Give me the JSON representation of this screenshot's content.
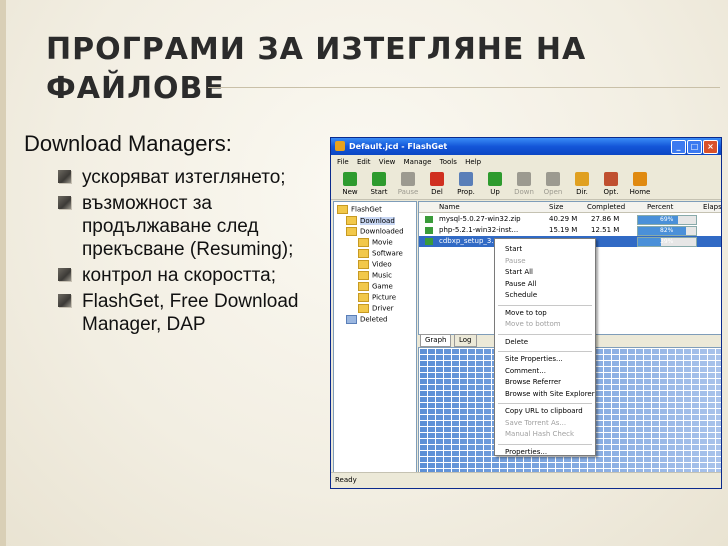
{
  "slide": {
    "title": "ПРОГРАМИ ЗА ИЗТЕГЛЯНЕ НА ФАЙЛОВЕ",
    "subtitle": "Download Managers:",
    "bullets": [
      "ускоряват изтеглянето;",
      "възможност за продължаване след прекъсване (Resuming);",
      "контрол на скоростта;",
      "FlashGet, Free Download Manager, DAP"
    ]
  },
  "window": {
    "title": "Default.jcd - FlashGet",
    "menu": [
      "File",
      "Edit",
      "View",
      "Manage",
      "Tools",
      "Help"
    ],
    "toolbar": [
      {
        "label": "New",
        "icon": "new-plus-icon",
        "color": "#2e9b2e",
        "enabled": true
      },
      {
        "label": "Start",
        "icon": "start-play-icon",
        "color": "#2e9b2e",
        "enabled": true
      },
      {
        "label": "Pause",
        "icon": "pause-icon",
        "color": "#9c9a90",
        "enabled": false
      },
      {
        "label": "Del",
        "icon": "delete-x-icon",
        "color": "#d03020",
        "enabled": true
      },
      {
        "label": "Prop.",
        "icon": "properties-icon",
        "color": "#5a7fb8",
        "enabled": true
      },
      {
        "label": "Up",
        "icon": "arrow-up-icon",
        "color": "#2e9b2e",
        "enabled": true
      },
      {
        "label": "Down",
        "icon": "arrow-down-icon",
        "color": "#9c9a90",
        "enabled": false
      },
      {
        "label": "Open",
        "icon": "open-arrow-icon",
        "color": "#9c9a90",
        "enabled": false
      },
      {
        "label": "Dir.",
        "icon": "directory-icon",
        "color": "#e0a020",
        "enabled": true
      },
      {
        "label": "Opt.",
        "icon": "options-icon",
        "color": "#c05030",
        "enabled": true
      },
      {
        "label": "Home",
        "icon": "home-icon",
        "color": "#e08a10",
        "enabled": true
      }
    ],
    "tree": {
      "root": "FlashGet",
      "download": "Download",
      "downloaded": "Downloaded",
      "children": [
        "Movie",
        "Software",
        "Video",
        "Music",
        "Game",
        "Picture",
        "Driver"
      ],
      "deleted": "Deleted"
    },
    "columns": [
      "Name",
      "Size",
      "Completed",
      "Percent",
      "Elaps"
    ],
    "rows": [
      {
        "name": "mysql-5.0.27-win32.zip",
        "size": "40.29 M",
        "completed": "27.86 M",
        "percent": "69%",
        "fraction": 0.69
      },
      {
        "name": "php-5.2.1-win32-inst...",
        "size": "15.19 M",
        "completed": "12.51 M",
        "percent": "82%",
        "fraction": 0.82
      },
      {
        "name": "cdbxp_setup_3.0...",
        "size": "",
        "completed": "",
        "percent": "39%",
        "fraction": 0.39
      }
    ],
    "tabs": [
      "Graph",
      "Log"
    ],
    "status": "Ready"
  },
  "context_menu": {
    "groups": [
      [
        {
          "label": "Start",
          "enabled": true
        },
        {
          "label": "Pause",
          "enabled": false
        },
        {
          "label": "Start All",
          "enabled": true
        },
        {
          "label": "Pause All",
          "enabled": true
        },
        {
          "label": "Schedule",
          "enabled": true
        }
      ],
      [
        {
          "label": "Move to top",
          "enabled": true
        },
        {
          "label": "Move to bottom",
          "enabled": false
        }
      ],
      [
        {
          "label": "Delete",
          "enabled": true
        }
      ],
      [
        {
          "label": "Site Properties...",
          "enabled": true
        },
        {
          "label": "Comment...",
          "enabled": true
        },
        {
          "label": "Browse Referrer",
          "enabled": true
        },
        {
          "label": "Browse with Site Explorer",
          "enabled": true
        }
      ],
      [
        {
          "label": "Copy URL to clipboard",
          "enabled": true
        },
        {
          "label": "Save Torrent As...",
          "enabled": false
        },
        {
          "label": "Manual Hash Check",
          "enabled": false
        }
      ],
      [
        {
          "label": "Properties...",
          "enabled": true
        }
      ]
    ]
  }
}
